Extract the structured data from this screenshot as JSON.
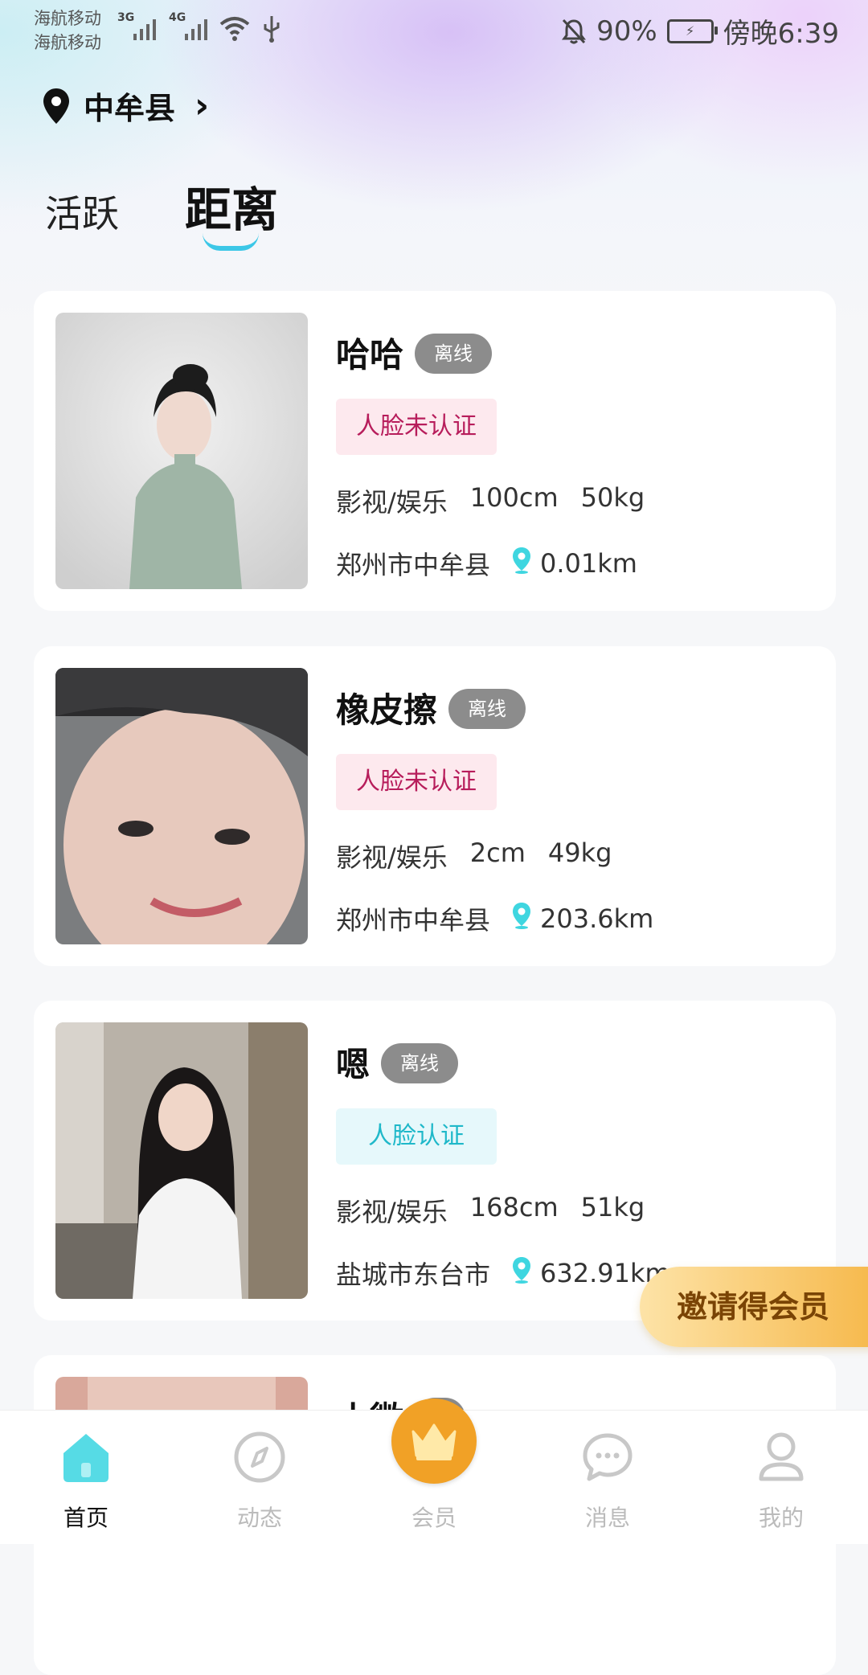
{
  "status_bar": {
    "carrier_1": "海航移动",
    "carrier_2": "海航移动",
    "net_1": "3G",
    "net_2": "4G",
    "battery_percent": "90%",
    "time": "傍晚6:39"
  },
  "location": {
    "label": "中牟县"
  },
  "tabs": [
    {
      "label": "活跃",
      "active": false
    },
    {
      "label": "距离",
      "active": true
    }
  ],
  "users": [
    {
      "name": "哈哈",
      "status": "离线",
      "verify": "人脸未认证",
      "verified": false,
      "job": "影视/娱乐",
      "height": "100cm",
      "weight": "50kg",
      "city": "郑州市中牟县",
      "distance": "0.01km"
    },
    {
      "name": "橡皮擦",
      "status": "离线",
      "verify": "人脸未认证",
      "verified": false,
      "job": "影视/娱乐",
      "height": "2cm",
      "weight": "49kg",
      "city": "郑州市中牟县",
      "distance": "203.6km"
    },
    {
      "name": "嗯",
      "status": "离线",
      "verify": "人脸认证",
      "verified": true,
      "job": "影视/娱乐",
      "height": "168cm",
      "weight": "51kg",
      "city": "盐城市东台市",
      "distance": "632.91km"
    },
    {
      "name": "小微"
    }
  ],
  "invite_button": "邀请得会员",
  "bottom_nav": [
    {
      "label": "首页",
      "icon": "home-icon",
      "active": true
    },
    {
      "label": "动态",
      "icon": "compass-icon",
      "active": false
    },
    {
      "label": "会员",
      "icon": "crown-icon",
      "active": false
    },
    {
      "label": "消息",
      "icon": "message-icon",
      "active": false
    },
    {
      "label": "我的",
      "icon": "user-icon",
      "active": false
    }
  ],
  "colors": {
    "accent": "#3cc7e7",
    "crown": "#f1a126",
    "invite": "#f6b84a"
  }
}
